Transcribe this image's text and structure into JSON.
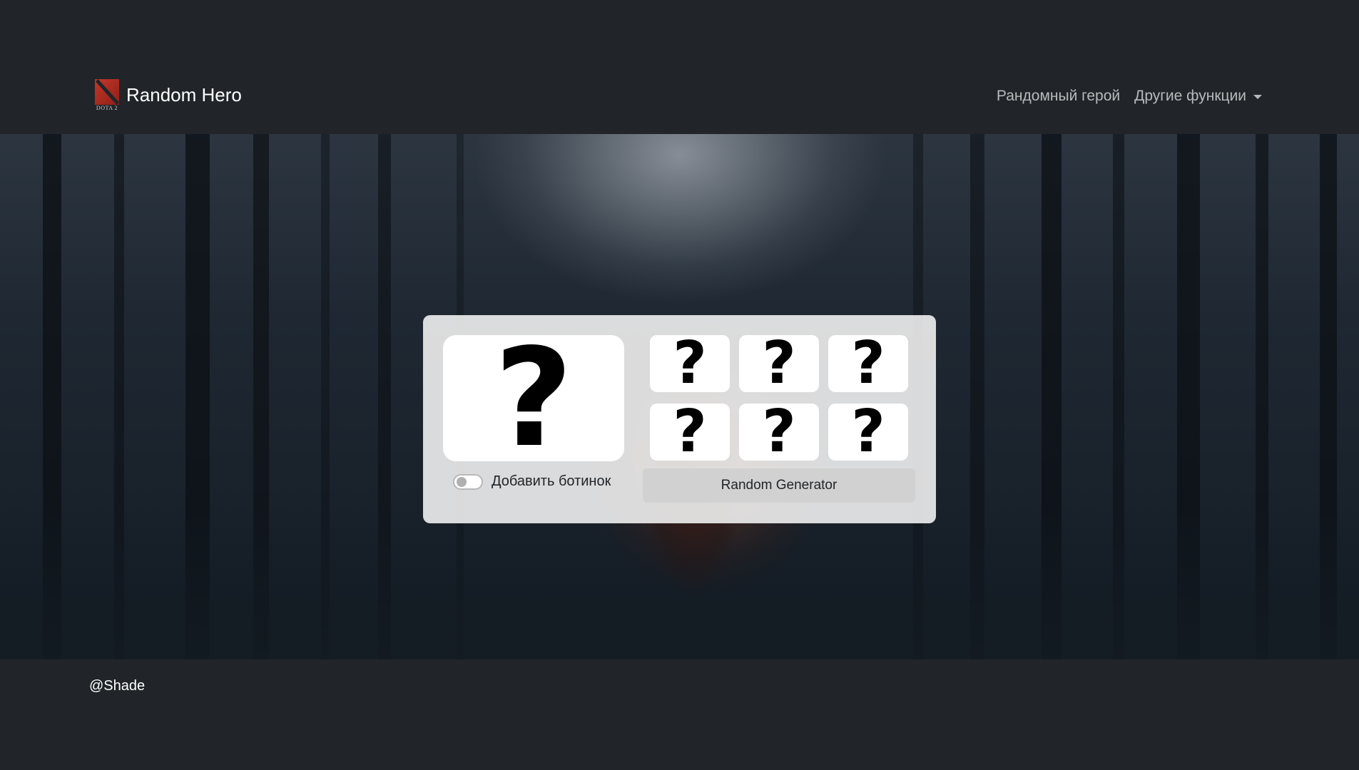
{
  "navbar": {
    "brand_title": "Random Hero",
    "logo_caption": "DOTA 2",
    "links": [
      {
        "label": "Рандомный герой"
      },
      {
        "label": "Другие функции"
      }
    ]
  },
  "card": {
    "main_slot": "?",
    "slots": [
      "?",
      "?",
      "?",
      "?",
      "?",
      "?"
    ],
    "toggle_label": "Добавить ботинок",
    "toggle_on": false,
    "button_label": "Random Generator"
  },
  "footer": {
    "text": "@Shade"
  }
}
